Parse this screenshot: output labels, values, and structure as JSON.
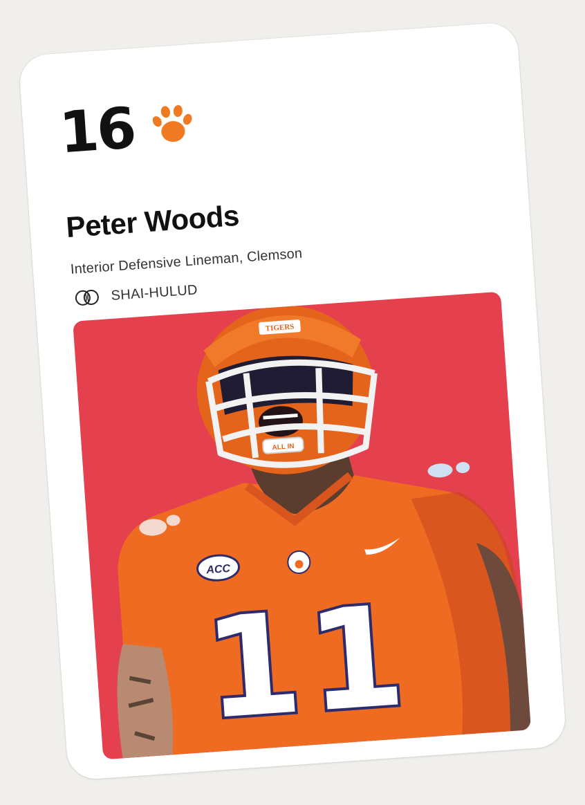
{
  "player": {
    "rank": "16",
    "name": "Peter Woods",
    "position_school": "Interior Defensive Lineman, Clemson",
    "team_label": "SHAI-HULUD",
    "jersey_number": "11",
    "helmet_text": "TIGERS",
    "chin_text": "ALL IN",
    "patch_text": "ACC"
  },
  "colors": {
    "photo_background": "#e5404e",
    "clemson_orange": "#f06b22",
    "jersey_shadow": "#c6461c",
    "paw_orange": "#ef7a22"
  },
  "icons": {
    "school_logo": "paw-icon",
    "team_logo": "rings-icon"
  }
}
